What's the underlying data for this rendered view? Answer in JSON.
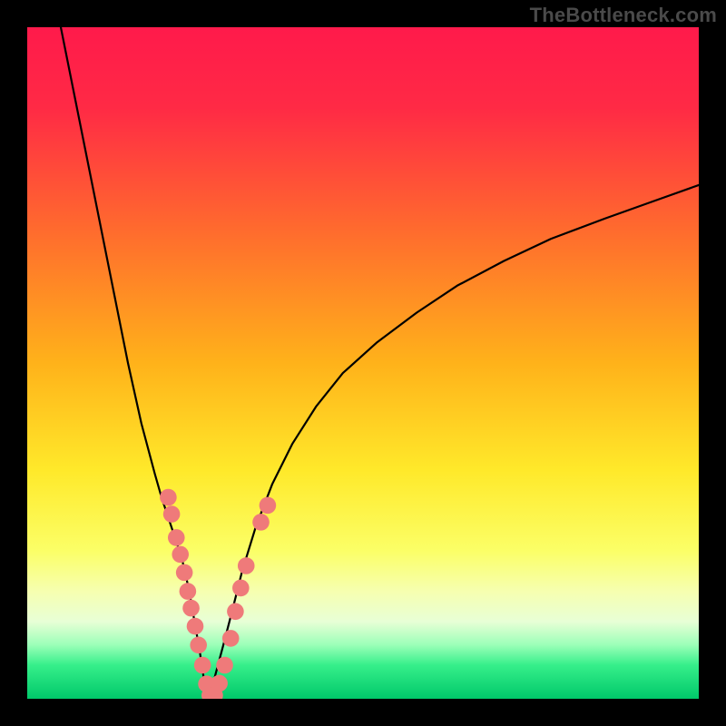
{
  "watermark": "TheBottleneck.com",
  "chart_data": {
    "type": "line",
    "title": "",
    "xlabel": "",
    "ylabel": "",
    "xlim": [
      0,
      100
    ],
    "ylim": [
      0,
      100
    ],
    "background_gradient_stops": [
      {
        "offset": 0.0,
        "color": "#ff1a4b"
      },
      {
        "offset": 0.12,
        "color": "#ff2a45"
      },
      {
        "offset": 0.3,
        "color": "#ff6a2e"
      },
      {
        "offset": 0.5,
        "color": "#ffb21a"
      },
      {
        "offset": 0.66,
        "color": "#ffe92a"
      },
      {
        "offset": 0.78,
        "color": "#fbff67"
      },
      {
        "offset": 0.84,
        "color": "#f6ffb0"
      },
      {
        "offset": 0.885,
        "color": "#e8ffd6"
      },
      {
        "offset": 0.92,
        "color": "#9bffb8"
      },
      {
        "offset": 0.95,
        "color": "#36ef8a"
      },
      {
        "offset": 1.0,
        "color": "#00c86a"
      }
    ],
    "series": [
      {
        "name": "left-curve",
        "color": "#000000",
        "width": 2.2,
        "x": [
          5,
          7,
          9,
          11,
          13,
          15,
          17,
          19,
          20,
          21,
          22,
          23,
          23.7,
          24.3,
          25,
          25.7,
          26.3,
          27
        ],
        "y": [
          100,
          90,
          80,
          70,
          60,
          50,
          41,
          33.5,
          30,
          27,
          24,
          21,
          18,
          15,
          11,
          7,
          3,
          0
        ]
      },
      {
        "name": "right-curve",
        "color": "#000000",
        "width": 2.2,
        "x": [
          27,
          28,
          29.2,
          30.5,
          32,
          34,
          36.5,
          39.5,
          43,
          47,
          52,
          58,
          64,
          71,
          78,
          86,
          93,
          100
        ],
        "y": [
          0,
          3.5,
          8,
          13,
          19,
          25.5,
          32,
          38,
          43.5,
          48.5,
          53,
          57.5,
          61.5,
          65.2,
          68.5,
          71.5,
          74,
          76.5
        ]
      }
    ],
    "scatter": {
      "name": "dots",
      "color": "#ef7a7a",
      "radius": 9.3,
      "points": [
        {
          "x": 21.0,
          "y": 30.0
        },
        {
          "x": 21.5,
          "y": 27.5
        },
        {
          "x": 22.2,
          "y": 24.0
        },
        {
          "x": 22.8,
          "y": 21.5
        },
        {
          "x": 23.4,
          "y": 18.8
        },
        {
          "x": 23.9,
          "y": 16.0
        },
        {
          "x": 24.4,
          "y": 13.5
        },
        {
          "x": 25.0,
          "y": 10.8
        },
        {
          "x": 25.5,
          "y": 8.0
        },
        {
          "x": 26.1,
          "y": 5.0
        },
        {
          "x": 26.7,
          "y": 2.2
        },
        {
          "x": 27.2,
          "y": 0.5
        },
        {
          "x": 27.9,
          "y": 0.5
        },
        {
          "x": 28.6,
          "y": 2.3
        },
        {
          "x": 29.4,
          "y": 5.0
        },
        {
          "x": 30.3,
          "y": 9.0
        },
        {
          "x": 31.0,
          "y": 13.0
        },
        {
          "x": 31.8,
          "y": 16.5
        },
        {
          "x": 32.6,
          "y": 19.8
        },
        {
          "x": 34.8,
          "y": 26.3
        },
        {
          "x": 35.8,
          "y": 28.8
        }
      ]
    }
  }
}
